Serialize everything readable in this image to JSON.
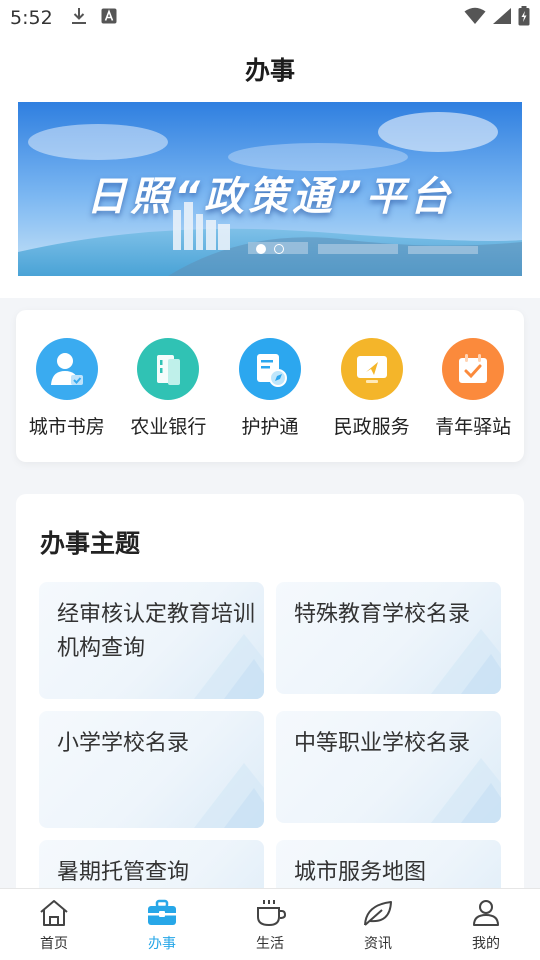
{
  "status_bar": {
    "time": "5:52",
    "icons": [
      "download-icon",
      "font-a-icon",
      "wifi-icon",
      "signal-icon",
      "battery-charging-icon"
    ]
  },
  "header": {
    "title": "办事"
  },
  "banner": {
    "title": "日照“政策通”平台",
    "page_count": 2,
    "active_page": 1
  },
  "services": [
    {
      "label": "城市书房",
      "icon": "user-card-icon",
      "color": "#3aabf0"
    },
    {
      "label": "农业银行",
      "icon": "bank-card-icon",
      "color": "#30c2b4"
    },
    {
      "label": "护护通",
      "icon": "document-compass-icon",
      "color": "#2ca7ef"
    },
    {
      "label": "民政服务",
      "icon": "monitor-icon",
      "color": "#f4b52a"
    },
    {
      "label": "青年驿站",
      "icon": "calendar-check-icon",
      "color": "#fb8a3c"
    }
  ],
  "topics": {
    "title": "办事主题",
    "items": [
      {
        "label": "经审核认定教育培训机构查询"
      },
      {
        "label": "特殊教育学校名录"
      },
      {
        "label": "小学学校名录"
      },
      {
        "label": "中等职业学校名录"
      },
      {
        "label": "暑期托管查询"
      },
      {
        "label": "城市服务地图"
      }
    ]
  },
  "tab_bar": {
    "tabs": [
      {
        "label": "首页",
        "icon": "home-icon"
      },
      {
        "label": "办事",
        "icon": "briefcase-icon"
      },
      {
        "label": "生活",
        "icon": "coffee-cup-icon"
      },
      {
        "label": "资讯",
        "icon": "leaf-icon"
      },
      {
        "label": "我的",
        "icon": "person-icon"
      }
    ],
    "active_index": 1,
    "active_color": "#27a7e8"
  }
}
